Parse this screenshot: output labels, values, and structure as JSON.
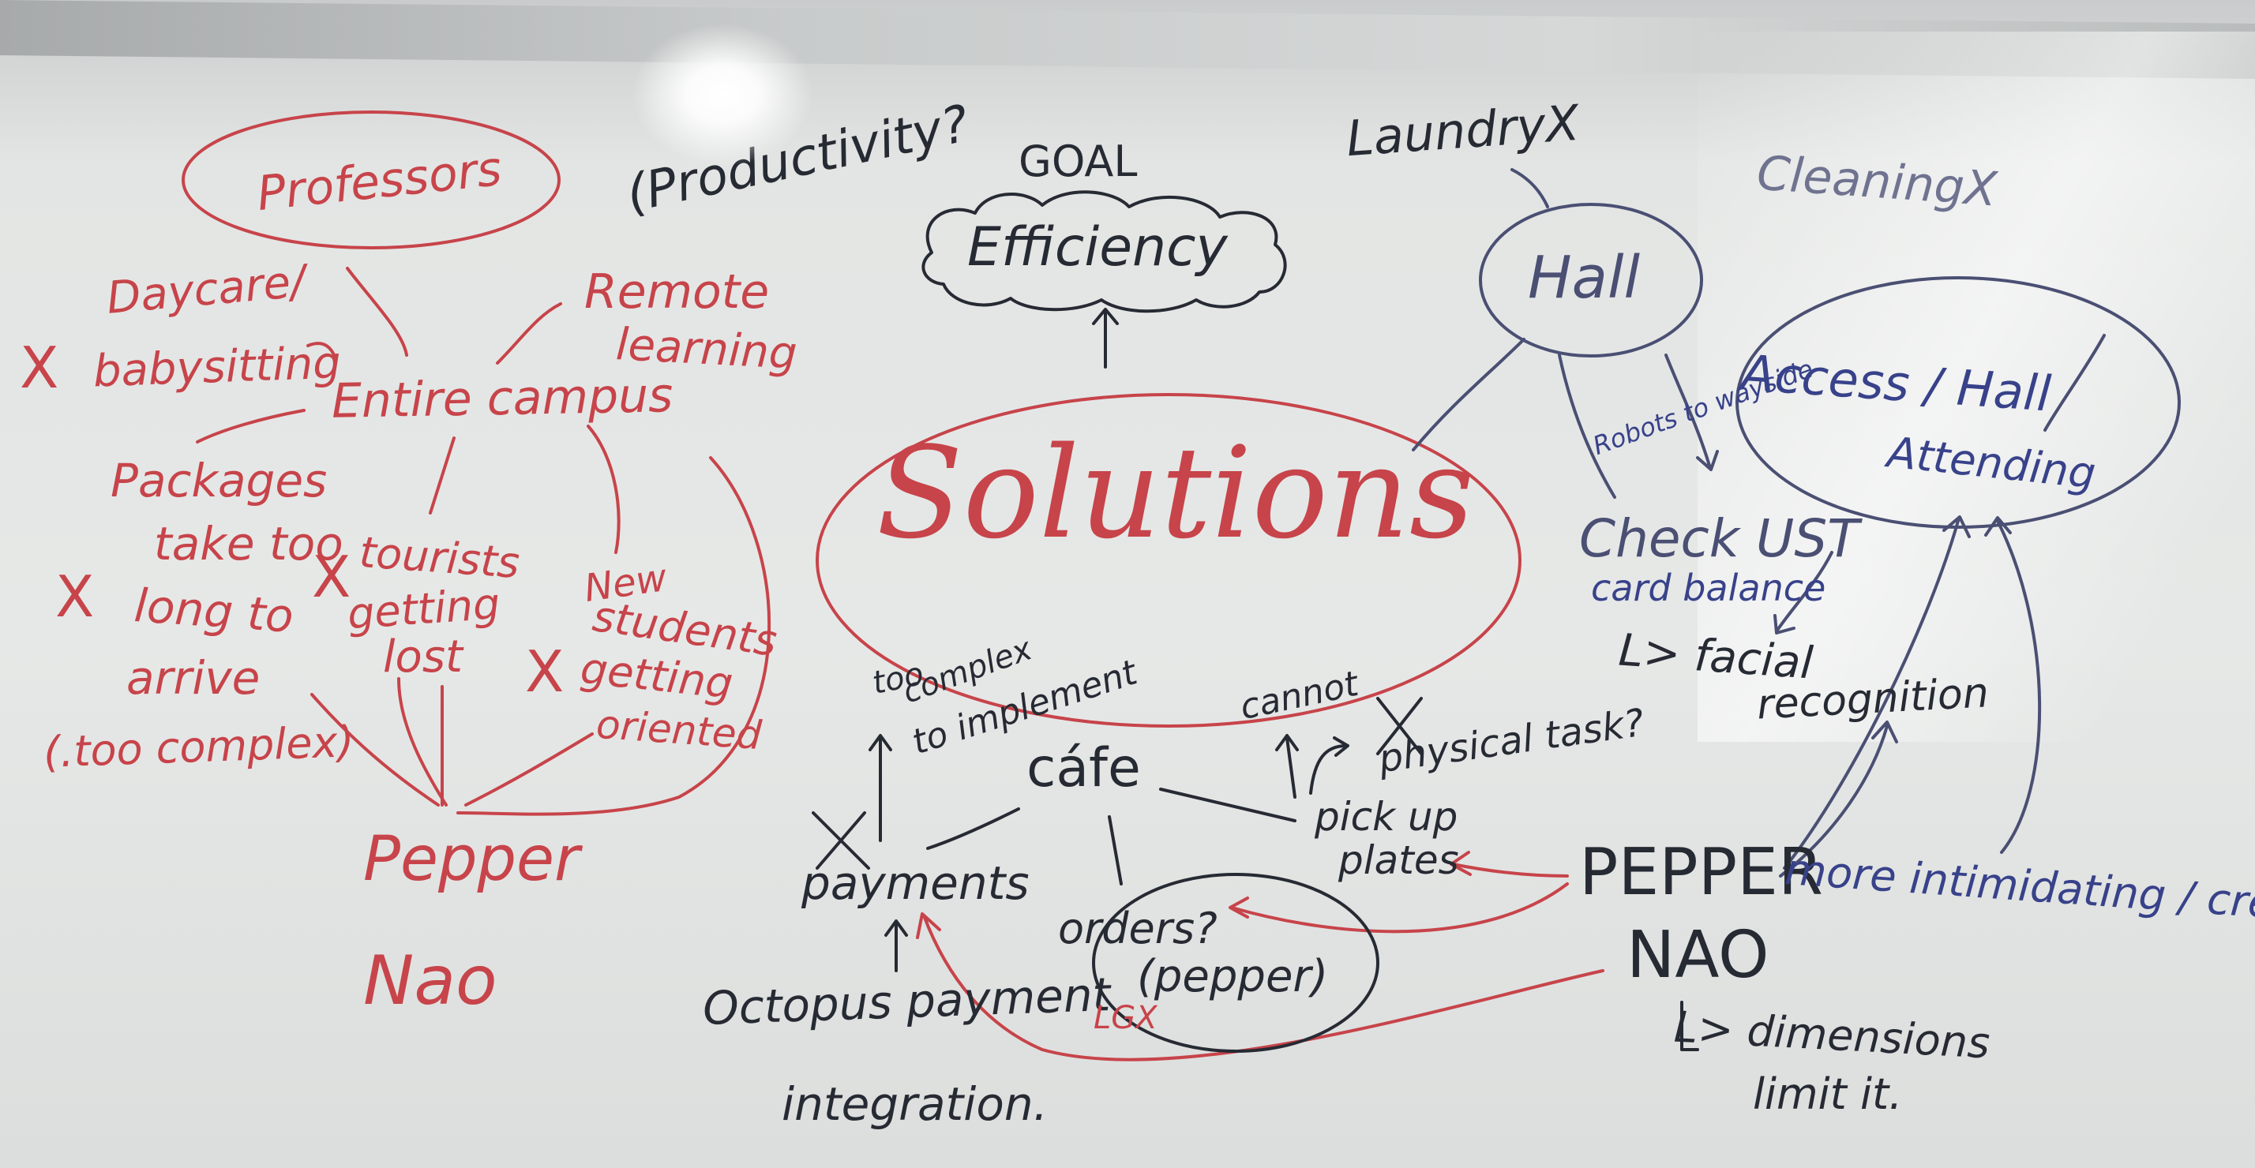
{
  "colors": {
    "red_ink": "#c7444a",
    "black_ink": "#262a33",
    "blue_ink": "#38428a",
    "board": "#e6e8e7"
  },
  "left": {
    "professors": "Professors",
    "daycare": "Daycare/",
    "babysitting": "babysitting",
    "remote": "Remote",
    "learning": "learning",
    "entire_campus": "Entire campus",
    "packages": "Packages",
    "take_too": "take too",
    "long_to": "long to",
    "arrive": "arrive",
    "too_complex": "(.too complex)",
    "tourists": "tourists",
    "getting_a": "getting",
    "lost": "lost",
    "new": "New",
    "students": "students",
    "getting_b": "getting",
    "oriented": "oriented",
    "pepper": "Pepper",
    "nao": "Nao",
    "x_mark": "X"
  },
  "center": {
    "productivity": "(Productivity?",
    "goal": "GOAL",
    "efficiency": "Efficiency",
    "solutions": "Solutions",
    "too_complex_1": "too",
    "too_complex_2": "complex",
    "too_complex_3": "to implement",
    "cafe": "cáfe",
    "payments": "payments",
    "octopus": "Octopus payment",
    "integration": "integration.",
    "orders": "orders?",
    "orders_pepper": "(pepper)",
    "lg": "LGX",
    "cannot": "cannot",
    "physical_task": "physical task?",
    "pick_up": "pick up",
    "plates": "plates"
  },
  "right": {
    "laundry": "LaundryX",
    "cleaning": "CleaningX",
    "hall": "Hall",
    "access": "Access / Hall",
    "attending": "Attending",
    "robot_wayside": "Robots to wayside",
    "check_ust": "Check UST",
    "card_balance": "card balance",
    "facial": "L> facial",
    "recognition": "recognition",
    "pepper": "PEPPER",
    "more_intimidating": "more intimidating / creepy",
    "nao": "NAO",
    "dimensions": "L> dimensions",
    "limit_it": "limit it."
  }
}
